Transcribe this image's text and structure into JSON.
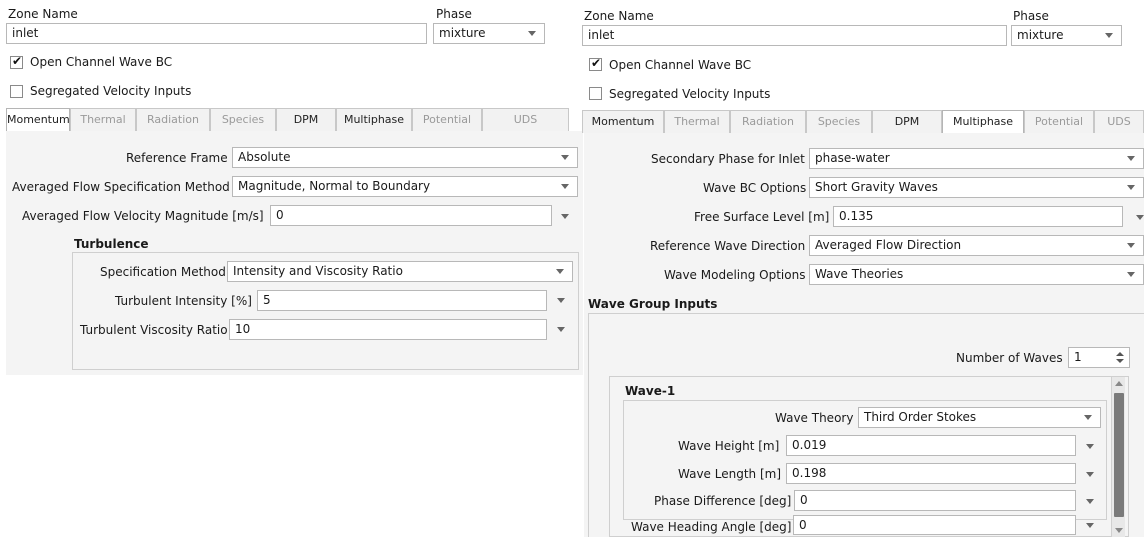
{
  "left": {
    "zone_label": "Zone Name",
    "zone_value": "inlet",
    "phase_label": "Phase",
    "phase_value": "mixture",
    "open_channel": "Open Channel Wave BC",
    "segregated": "Segregated Velocity Inputs",
    "tabs": [
      "Momentum",
      "Thermal",
      "Radiation",
      "Species",
      "DPM",
      "Multiphase",
      "Potential",
      "UDS"
    ],
    "active_tab": "Momentum",
    "ref_frame_label": "Reference Frame",
    "ref_frame_value": "Absolute",
    "flow_spec_label": "Averaged Flow Specification Method",
    "flow_spec_value": "Magnitude, Normal to Boundary",
    "vel_mag_label": "Averaged Flow Velocity Magnitude [m/s]",
    "vel_mag_value": "0",
    "turbulence_title": "Turbulence",
    "spec_method_label": "Specification Method",
    "spec_method_value": "Intensity and Viscosity Ratio",
    "turb_int_label": "Turbulent Intensity [%]",
    "turb_int_value": "5",
    "turb_visc_label": "Turbulent Viscosity Ratio",
    "turb_visc_value": "10"
  },
  "right": {
    "zone_label": "Zone Name",
    "zone_value": "inlet",
    "phase_label": "Phase",
    "phase_value": "mixture",
    "open_channel": "Open Channel Wave BC",
    "segregated": "Segregated Velocity Inputs",
    "tabs": [
      "Momentum",
      "Thermal",
      "Radiation",
      "Species",
      "DPM",
      "Multiphase",
      "Potential",
      "UDS"
    ],
    "active_tab": "Multiphase",
    "sec_phase_label": "Secondary Phase for Inlet",
    "sec_phase_value": "phase-water",
    "wave_bc_label": "Wave BC Options",
    "wave_bc_value": "Short Gravity Waves",
    "free_surface_label": "Free Surface Level [m]",
    "free_surface_value": "0.135",
    "ref_dir_label": "Reference Wave Direction",
    "ref_dir_value": "Averaged Flow Direction",
    "wave_model_label": "Wave Modeling Options",
    "wave_model_value": "Wave Theories",
    "wave_group_title": "Wave Group Inputs",
    "num_waves_label": "Number of Waves",
    "num_waves_value": "1",
    "wave1_title": "Wave-1",
    "wave_theory_label": "Wave Theory",
    "wave_theory_value": "Third Order Stokes",
    "wave_height_label": "Wave Height [m]",
    "wave_height_value": "0.019",
    "wave_length_label": "Wave Length [m]",
    "wave_length_value": "0.198",
    "phase_diff_label": "Phase Difference [deg]",
    "phase_diff_value": "0",
    "heading_label": "Wave Heading Angle [deg]",
    "heading_value": "0"
  },
  "colors": {
    "panel_bg": "#f4f4f4",
    "scroll_thumb": "#7a7a7a"
  }
}
